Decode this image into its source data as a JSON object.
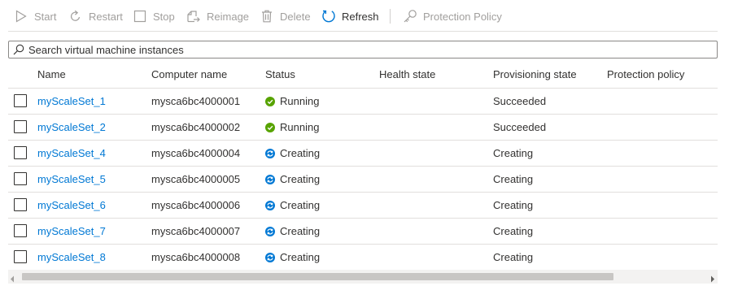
{
  "toolbar": {
    "start_label": "Start",
    "restart_label": "Restart",
    "stop_label": "Stop",
    "reimage_label": "Reimage",
    "delete_label": "Delete",
    "refresh_label": "Refresh",
    "protection_policy_label": "Protection Policy"
  },
  "search": {
    "placeholder": "Search virtual machine instances"
  },
  "columns": {
    "name": "Name",
    "computer_name": "Computer name",
    "status": "Status",
    "health_state": "Health state",
    "provisioning_state": "Provisioning state",
    "protection_policy": "Protection policy"
  },
  "rows": [
    {
      "name": "myScaleSet_1",
      "computer_name": "mysca6bc4000001",
      "status": "Running",
      "status_icon": "check-circle-icon",
      "health_state": "",
      "provisioning_state": "Succeeded",
      "protection_policy": ""
    },
    {
      "name": "myScaleSet_2",
      "computer_name": "mysca6bc4000002",
      "status": "Running",
      "status_icon": "check-circle-icon",
      "health_state": "",
      "provisioning_state": "Succeeded",
      "protection_policy": ""
    },
    {
      "name": "myScaleSet_4",
      "computer_name": "mysca6bc4000004",
      "status": "Creating",
      "status_icon": "sync-icon",
      "health_state": "",
      "provisioning_state": "Creating",
      "protection_policy": ""
    },
    {
      "name": "myScaleSet_5",
      "computer_name": "mysca6bc4000005",
      "status": "Creating",
      "status_icon": "sync-icon",
      "health_state": "",
      "provisioning_state": "Creating",
      "protection_policy": ""
    },
    {
      "name": "myScaleSet_6",
      "computer_name": "mysca6bc4000006",
      "status": "Creating",
      "status_icon": "sync-icon",
      "health_state": "",
      "provisioning_state": "Creating",
      "protection_policy": ""
    },
    {
      "name": "myScaleSet_7",
      "computer_name": "mysca6bc4000007",
      "status": "Creating",
      "status_icon": "sync-icon",
      "health_state": "",
      "provisioning_state": "Creating",
      "protection_policy": ""
    },
    {
      "name": "myScaleSet_8",
      "computer_name": "mysca6bc4000008",
      "status": "Creating",
      "status_icon": "sync-icon",
      "health_state": "",
      "provisioning_state": "Creating",
      "protection_policy": ""
    }
  ],
  "colors": {
    "link": "#0078d4",
    "running": "#57a300",
    "creating": "#0078d4",
    "disabled_text": "#a19f9d"
  }
}
